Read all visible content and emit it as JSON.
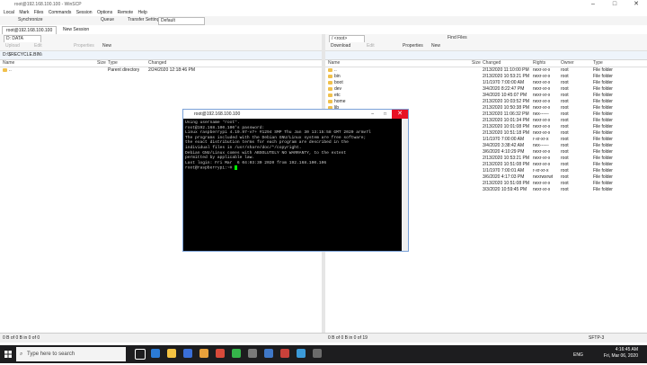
{
  "window": {
    "title": "root@192.168.100.100 - WinSCP"
  },
  "menu": [
    "Local",
    "Mark",
    "Files",
    "Commands",
    "Session",
    "Options",
    "Remote",
    "Help"
  ],
  "toolbar": {
    "sync": "Synchronize",
    "queue": "Queue",
    "transfer_label": "Transfer Settings",
    "transfer_value": "Default"
  },
  "tabs": {
    "session": "root@192.168.100.100",
    "new_session": "New Session"
  },
  "left": {
    "drive": "D: DATA",
    "upload": "Upload",
    "edit": "Edit",
    "properties": "Properties",
    "new": "New",
    "path": "D:\\$RECYCLE.BIN\\",
    "columns": [
      "Name",
      "Size",
      "Type",
      "Changed"
    ],
    "rows": [
      {
        "name": "..",
        "type": "Parent directory",
        "changed": "2/24/2020 12:18:46 PM"
      }
    ],
    "status": "0 B of 0 B in 0 of 0"
  },
  "right": {
    "drive": "/ <root>",
    "find": "Find Files",
    "download": "Download",
    "edit": "Edit",
    "properties": "Properties",
    "new": "New",
    "columns": [
      "Name",
      "Size",
      "Changed",
      "Rights",
      "Owner",
      "Type"
    ],
    "rows": [
      {
        "name": "..",
        "changed": "2/13/2020 11:10:00 PM",
        "rights": "rwxr-xr-x",
        "owner": "root",
        "type": "File folder"
      },
      {
        "name": "bin",
        "changed": "2/13/2020 10:53:21 PM",
        "rights": "rwxr-xr-x",
        "owner": "root",
        "type": "File folder"
      },
      {
        "name": "boot",
        "changed": "1/1/1970 7:00:00 AM",
        "rights": "rwxr-xr-x",
        "owner": "root",
        "type": "File folder"
      },
      {
        "name": "dev",
        "changed": "3/4/2020 8:22:47 PM",
        "rights": "rwxr-xr-x",
        "owner": "root",
        "type": "File folder"
      },
      {
        "name": "etc",
        "changed": "3/4/2020 10:45:07 PM",
        "rights": "rwxr-xr-x",
        "owner": "root",
        "type": "File folder"
      },
      {
        "name": "home",
        "changed": "2/13/2020 10:03:52 PM",
        "rights": "rwxr-xr-x",
        "owner": "root",
        "type": "File folder"
      },
      {
        "name": "lib",
        "changed": "2/13/2020 10:50:38 PM",
        "rights": "rwxr-xr-x",
        "owner": "root",
        "type": "File folder"
      },
      {
        "name": "lost+found",
        "changed": "2/13/2020 11:06:32 PM",
        "rights": "rwx------",
        "owner": "root",
        "type": "File folder"
      },
      {
        "name": "media",
        "changed": "2/13/2020 10:01:34 PM",
        "rights": "rwxr-xr-x",
        "owner": "root",
        "type": "File folder"
      },
      {
        "name": "mnt",
        "changed": "2/13/2020 10:01:08 PM",
        "rights": "rwxr-xr-x",
        "owner": "root",
        "type": "File folder"
      },
      {
        "name": "opt",
        "changed": "2/13/2020 10:51:18 PM",
        "rights": "rwxr-xr-x",
        "owner": "root",
        "type": "File folder"
      },
      {
        "name": "proc",
        "changed": "1/1/1970 7:00:00 AM",
        "rights": "r-xr-xr-x",
        "owner": "root",
        "type": "File folder"
      },
      {
        "name": "root",
        "changed": "3/4/2020 3:38:42 AM",
        "rights": "rwx------",
        "owner": "root",
        "type": "File folder"
      },
      {
        "name": "run",
        "changed": "3/6/2020 4:10:29 PM",
        "rights": "rwxr-xr-x",
        "owner": "root",
        "type": "File folder"
      },
      {
        "name": "sbin",
        "changed": "2/13/2020 10:53:21 PM",
        "rights": "rwxr-xr-x",
        "owner": "root",
        "type": "File folder"
      },
      {
        "name": "srv",
        "changed": "2/13/2020 10:51:08 PM",
        "rights": "rwxr-xr-x",
        "owner": "root",
        "type": "File folder"
      },
      {
        "name": "sys",
        "changed": "1/1/1970 7:00:01 AM",
        "rights": "r-xr-xr-x",
        "owner": "root",
        "type": "File folder"
      },
      {
        "name": "tmp",
        "changed": "3/6/2020 4:17:03 PM",
        "rights": "rwxrwxrwt",
        "owner": "root",
        "type": "File folder"
      },
      {
        "name": "usr",
        "changed": "2/13/2020 10:51:08 PM",
        "rights": "rwxr-xr-x",
        "owner": "root",
        "type": "File folder"
      },
      {
        "name": "var",
        "changed": "3/3/2020 10:59:45 PM",
        "rights": "rwxr-xr-x",
        "owner": "root",
        "type": "File folder"
      }
    ],
    "status": "0 B of 0 B in 0 of 19"
  },
  "status_right": "SFTP-3",
  "putty": {
    "title": "root@192.168.100.100",
    "lines": [
      "Using username \"root\".",
      "root@192.168.100.100's password:",
      "Linux raspberrypi 4.19.97-v7+ #1294 SMP Thu Jan 30 13:15:58 GMT 2020 armv7l",
      "",
      "The programs included with the Debian GNU/Linux system are free software;",
      "the exact distribution terms for each program are described in the",
      "individual files in /usr/share/doc/*/copyright.",
      "",
      "Debian GNU/Linux comes with ABSOLUTELY NO WARRANTY, to the extent",
      "permitted by applicable law.",
      "Last login: Fri Mar  6 04:03:30 2020 from 192.168.100.106",
      "root@raspberrypi:~# "
    ]
  },
  "taskbar": {
    "search_placeholder": "Type here to search",
    "time": "4:16:45 AM",
    "date": "Fri, Mar 06, 2020",
    "lang": "ENG"
  },
  "colors": {
    "accent": "#0078d7",
    "close": "#e81123",
    "folder": "#f0c04c"
  }
}
